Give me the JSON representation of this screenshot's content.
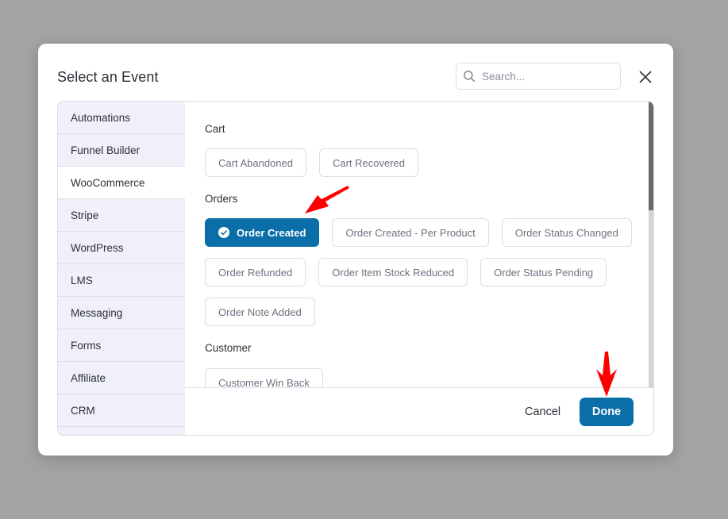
{
  "dialog": {
    "title": "Select an Event",
    "search_placeholder": "Search...",
    "close_icon": "close-icon",
    "search_icon": "search-icon"
  },
  "sidebar": {
    "items": [
      {
        "label": "Automations",
        "active": false
      },
      {
        "label": "Funnel Builder",
        "active": false
      },
      {
        "label": "WooCommerce",
        "active": true
      },
      {
        "label": "Stripe",
        "active": false
      },
      {
        "label": "WordPress",
        "active": false
      },
      {
        "label": "LMS",
        "active": false
      },
      {
        "label": "Messaging",
        "active": false
      },
      {
        "label": "Forms",
        "active": false
      },
      {
        "label": "Affiliate",
        "active": false
      },
      {
        "label": "CRM",
        "active": false
      }
    ]
  },
  "groups": [
    {
      "label": "Cart",
      "events": [
        {
          "label": "Cart Abandoned",
          "selected": false
        },
        {
          "label": "Cart Recovered",
          "selected": false
        }
      ]
    },
    {
      "label": "Orders",
      "events": [
        {
          "label": "Order Created",
          "selected": true
        },
        {
          "label": "Order Created - Per Product",
          "selected": false
        },
        {
          "label": "Order Status Changed",
          "selected": false
        },
        {
          "label": "Order Refunded",
          "selected": false
        },
        {
          "label": "Order Item Stock Reduced",
          "selected": false
        },
        {
          "label": "Order Status Pending",
          "selected": false
        },
        {
          "label": "Order Note Added",
          "selected": false
        }
      ]
    },
    {
      "label": "Customer",
      "events": [
        {
          "label": "Customer Win Back",
          "selected": false
        }
      ]
    }
  ],
  "footer": {
    "cancel_label": "Cancel",
    "done_label": "Done"
  },
  "colors": {
    "primary": "#0a6ea8",
    "annotation_arrow": "#ff0000",
    "overlay": "#a3a3a3",
    "sidebar_bg": "#f0f0f8"
  }
}
